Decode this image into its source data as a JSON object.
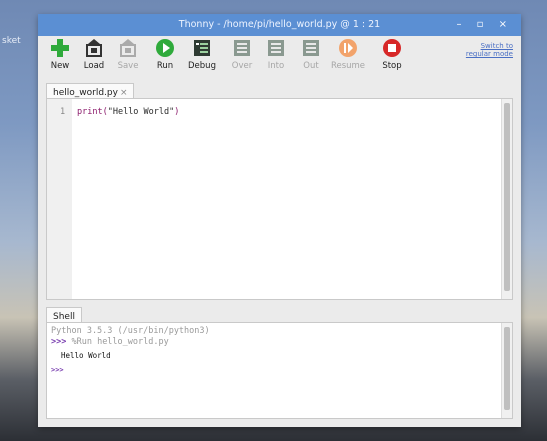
{
  "desktop": {
    "label": "sket"
  },
  "window": {
    "title": "Thonny - /home/pi/hello_world.py @ 1 : 21",
    "controls": "– ▫ ×"
  },
  "toolbar": {
    "buttons": [
      {
        "label": "New",
        "icon": "new-plus-icon",
        "enabled": true
      },
      {
        "label": "Load",
        "icon": "load-icon",
        "enabled": true
      },
      {
        "label": "Save",
        "icon": "save-icon",
        "enabled": false
      },
      {
        "label": "Run",
        "icon": "run-icon",
        "enabled": true
      },
      {
        "label": "Debug",
        "icon": "debug-icon",
        "enabled": true
      },
      {
        "label": "Over",
        "icon": "step-over-icon",
        "enabled": false
      },
      {
        "label": "Into",
        "icon": "step-into-icon",
        "enabled": false
      },
      {
        "label": "Out",
        "icon": "step-out-icon",
        "enabled": false
      },
      {
        "label": "Resume",
        "icon": "resume-icon",
        "enabled": false
      },
      {
        "label": "Stop",
        "icon": "stop-icon",
        "enabled": true
      }
    ],
    "switch_line1": "Switch to",
    "switch_line2": "regular mode"
  },
  "editor": {
    "tab_label": "hello_world.py",
    "tab_close": "×",
    "line_number": "1",
    "code_func": "print(",
    "code_str": "\"Hello World\"",
    "code_end": ")"
  },
  "shell": {
    "tab_label": "Shell",
    "version_line": "Python 3.5.3 (/usr/bin/python3)",
    "prompt": ">>>",
    "run_command": "%Run hello_world.py",
    "output": "Hello World",
    "prompt2": ">>>"
  },
  "colors": {
    "titlebar": "#5b8fd3",
    "accent_green": "#2faa3b",
    "stop_red": "#d72828",
    "resume_orange": "#f2a36b"
  }
}
